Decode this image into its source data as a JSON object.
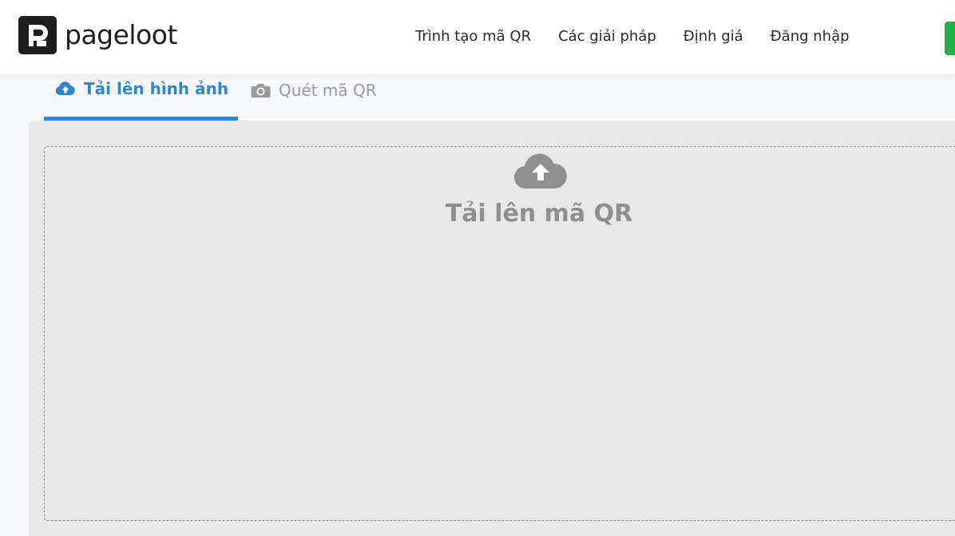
{
  "brand": {
    "name": "pageloot",
    "logo_icon": "pageloot-logo-icon"
  },
  "nav": {
    "items": [
      {
        "label": "Trình tạo mã QR"
      },
      {
        "label": "Các giải pháp"
      },
      {
        "label": "Định giá"
      },
      {
        "label": "Đăng nhập"
      }
    ]
  },
  "tabs": [
    {
      "label": "Tải lên hình ảnh",
      "icon": "cloud-upload-icon",
      "active": true
    },
    {
      "label": "Quét mã QR",
      "icon": "camera-icon",
      "active": false
    }
  ],
  "dropzone": {
    "label": "Tải lên mã QR",
    "icon": "cloud-upload-icon"
  },
  "colors": {
    "accent": "#3385d6",
    "cta_green": "#1fb141",
    "panel_bg": "#e8e8e8",
    "muted_text": "#8f8f8f"
  }
}
